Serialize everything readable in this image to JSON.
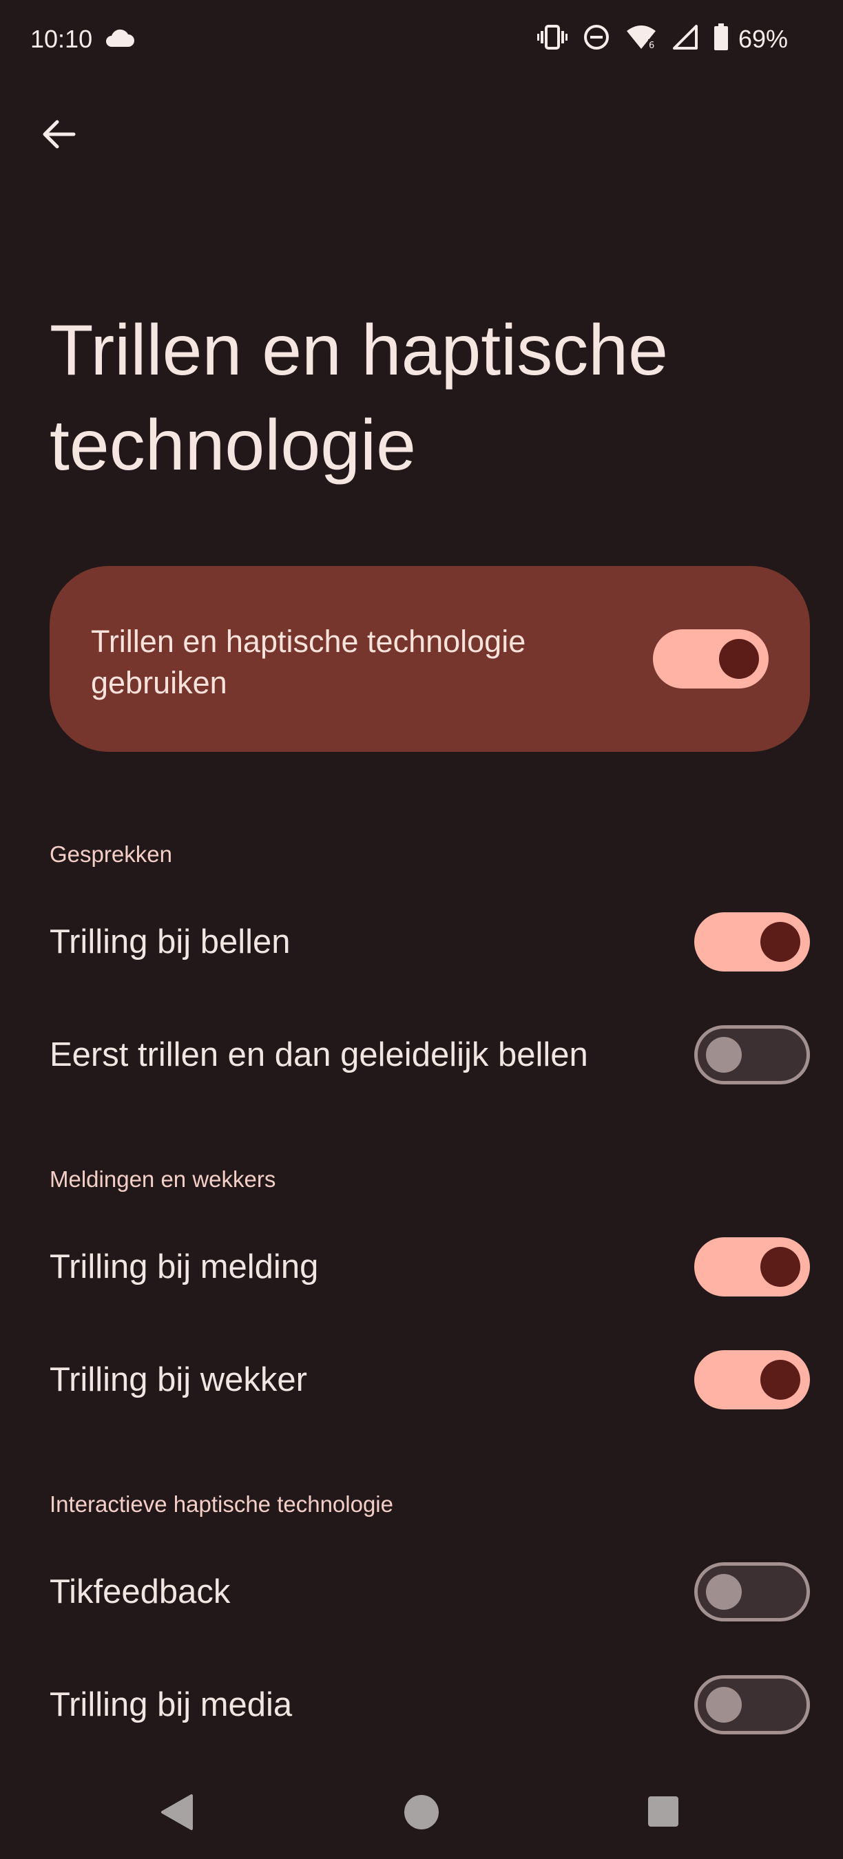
{
  "status": {
    "time": "10:10",
    "battery": "69%",
    "icons": [
      "cloud-icon",
      "vibrate-icon",
      "dnd-icon",
      "wifi-icon",
      "signal-icon",
      "battery-icon"
    ]
  },
  "header": {
    "title": "Trillen en haptische technologie"
  },
  "main_toggle": {
    "label": "Trillen en haptische technologie gebruiken",
    "state": "on"
  },
  "sections": [
    {
      "header": "Gesprekken",
      "items": [
        {
          "label": "Trilling bij bellen",
          "state": "on"
        },
        {
          "label": "Eerst trillen en dan geleidelijk bellen",
          "state": "off"
        }
      ]
    },
    {
      "header": "Meldingen en wekkers",
      "items": [
        {
          "label": "Trilling bij melding",
          "state": "on"
        },
        {
          "label": "Trilling bij wekker",
          "state": "on"
        }
      ]
    },
    {
      "header": "Interactieve haptische technologie",
      "items": [
        {
          "label": "Tikfeedback",
          "state": "off"
        },
        {
          "label": "Trilling bij media",
          "state": "off"
        }
      ]
    }
  ],
  "colors": {
    "background": "#221819",
    "card": "#76362d",
    "switch_on_track": "#ffb3a5",
    "switch_on_knob": "#5c1c17",
    "switch_off_track": "#3c3032",
    "switch_off_border": "#a39090"
  }
}
